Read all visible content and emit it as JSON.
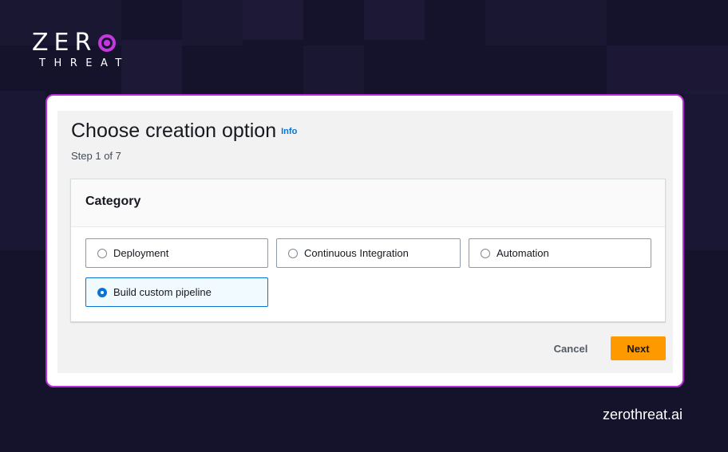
{
  "brand": {
    "logo_main": "ZER",
    "logo_sub": "THREAT",
    "website": "zerothreat.ai",
    "accent_color": "#c438e0"
  },
  "page": {
    "title": "Choose creation option",
    "info_link": "Info",
    "step": "Step 1 of 7"
  },
  "category": {
    "title": "Category",
    "options": [
      {
        "label": "Deployment",
        "selected": false
      },
      {
        "label": "Continuous Integration",
        "selected": false
      },
      {
        "label": "Automation",
        "selected": false
      },
      {
        "label": "Build custom pipeline",
        "selected": true
      }
    ]
  },
  "actions": {
    "cancel_label": "Cancel",
    "next_label": "Next",
    "next_color": "#ff9900"
  }
}
